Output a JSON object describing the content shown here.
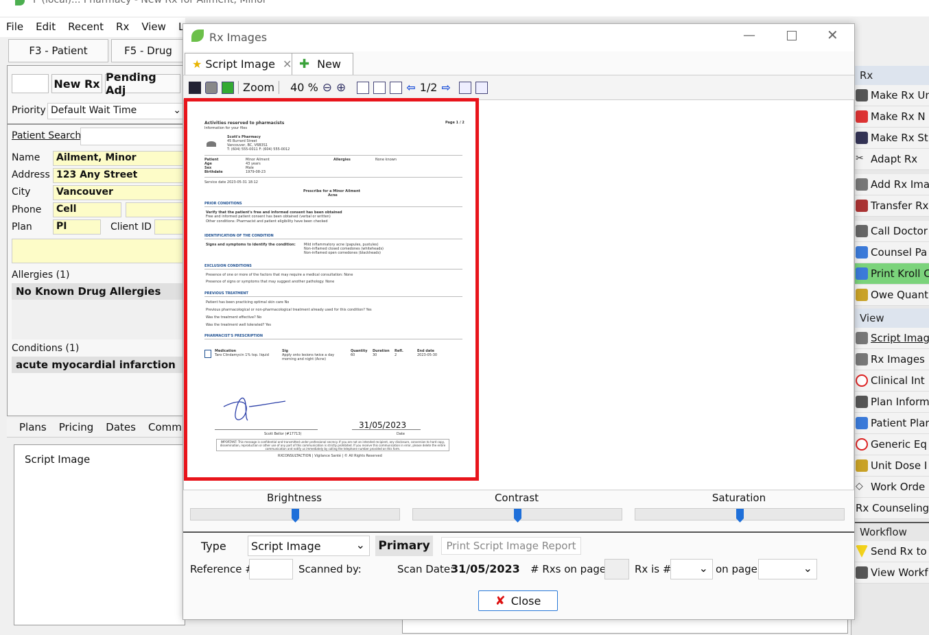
{
  "app": {
    "title": "F (local)... Pharmacy - New Rx for Ailment, Minor",
    "menu": [
      "File",
      "Edit",
      "Recent",
      "Rx",
      "View",
      "La"
    ],
    "fkeys": [
      "F3 - Patient",
      "F5 - Drug"
    ],
    "rxbuttons": [
      "New Rx",
      "Pending Adj"
    ],
    "priority_label": "Priority",
    "priority_value": "Default Wait Time",
    "patient_search_label": "Patient Search",
    "fields": {
      "name_label": "Name",
      "name": "Ailment, Minor",
      "address_label": "Address",
      "address": "123 Any Street",
      "city_label": "City",
      "city": "Vancouver",
      "phone_label": "Phone",
      "phone": "Cell",
      "plan_label": "Plan",
      "plan": "PI",
      "client_id_label": "Client ID"
    },
    "allergies_label": "Allergies (1)",
    "allergies_value": "No Known Drug Allergies",
    "conditions_label": "Conditions (1)",
    "conditions_value": "acute myocardial infarction",
    "bottom_tabs": [
      "Plans",
      "Pricing",
      "Dates",
      "Comm"
    ],
    "script_image_label": "Script Image"
  },
  "right_panel": {
    "rx_section": "Rx",
    "rx_items": [
      "Make Rx Un",
      "Make Rx N",
      "Make Rx St",
      "Adapt Rx",
      "Add Rx Ima",
      "Transfer Rx",
      "Call Doctor",
      "Counsel Pa",
      "Print Kroll C",
      "Owe Quant"
    ],
    "view_section": "View",
    "view_items": [
      "Script Imag",
      "Rx Images",
      "Clinical Int",
      "Plan Inform",
      "Patient Plar",
      "Generic Eq",
      "Unit Dose I",
      "Work Orde",
      "Rx Counseling"
    ],
    "workflow_section": "Workflow",
    "workflow_items": [
      "Send Rx to",
      "View Workf"
    ]
  },
  "dialog": {
    "title": "Rx Images",
    "tabs": [
      "Script Image",
      "New"
    ],
    "toolbar": {
      "zoom_label": "Zoom",
      "zoom_value": "40 %",
      "page": "1/2"
    },
    "sliders": [
      {
        "label": "Brightness",
        "value": 0.5
      },
      {
        "label": "Contrast",
        "value": 0.5
      },
      {
        "label": "Saturation",
        "value": 0.5
      }
    ],
    "type_label": "Type",
    "type_value": "Script Image",
    "primary_label": "Primary",
    "print_report_label": "Print Script Image Report",
    "reference_label": "Reference #",
    "scanned_by_label": "Scanned by:",
    "scan_date_label": "Scan Date:",
    "scan_date_value": "31/05/2023",
    "rxs_on_page_label": "# Rxs on page:",
    "rx_is_label": "Rx is #",
    "on_page_label": "on page",
    "close_label": "Close"
  },
  "document": {
    "title": "Activities reserved to pharmacists",
    "subtitle": "Information for your files",
    "page": "Page 1 / 2",
    "pharmacy": "Scott's Pharmacy",
    "pharmacy_address": "45 Burrard Street",
    "pharmacy_city": "Vancouver, BC, V6B3S1",
    "pharmacy_phone": "T: (604) 555-0011     F: (604) 555-0012",
    "patient_labels": [
      "Patient",
      "Age",
      "Sex",
      "Birthdate"
    ],
    "patient_values": [
      "Minor Ailment",
      "43 years",
      "Male",
      "1979-08-23"
    ],
    "allergies_label": "Allergies",
    "allergies_value": "None known",
    "service_date": "Service date  2023-05-31 18:12",
    "prescribe_for": "Prescribe for a Minor Ailment",
    "ailment": "Acne",
    "sections": [
      "PRIOR CONDITIONS",
      "IDENTIFICATION OF THE CONDITION",
      "EXCLUSION CONDITIONS",
      "PREVIOUS TREATMENT",
      "PHARMACIST'S PRESCRIPTION"
    ],
    "prior_1": "Verify that the patient's free and informed consent has been obtained",
    "prior_2": "Free and informed patient consent has been obtained (verbal or written)",
    "prior_3": "Other conditions:  Pharmacist and patient eligibility have been checked",
    "ident_label": "Signs and symptoms to identify the condition:",
    "ident_1": "Mild inflammatory acne (papules, pustules)",
    "ident_2": "Non-inflamed closed comedones (whiteheads)",
    "ident_3": "Non-inflamed open comedones (blackheads)",
    "excl_1": "Presence of one or more of the factors that may require a medical consultation:  None",
    "excl_2": "Presence of signs or symptoms that may suggest another pathology:  None",
    "prev_1": "Patient has been practicing optimal skin care  No",
    "prev_2": "Previous pharmacological or non-pharmacological treatment already used for this condition?  Yes",
    "prev_3": "Was the treatment effective?  No",
    "prev_4": "Was the treatment well tolerated?  Yes",
    "rx_headers": [
      "Medication",
      "Sig",
      "Quantity",
      "Duration",
      "Refl.",
      "End date"
    ],
    "rx_values": [
      "Taro Clindamycin 1% top. liquid",
      "Apply onto lesions twice a day",
      "60",
      "30",
      "2",
      "2023-05-30"
    ],
    "rx_sig2": "morning and night (Acne)",
    "signature_name": "Scott Bellor (#17713)",
    "date_value": "31/05/2023",
    "date_label": "Date",
    "footer": "IMPORTANT: This message is confidential and transmitted under professional secrecy. If you are not an intended recipient, any disclosure, conversion to hard copy, dissemination, reproduction or other use of any part of this communication is strictly prohibited. If you receive this communication in error, please delete the entire communication and notify us immediately by calling the telephone number provided on this form.",
    "footer_brand": "RXCONSULTACTION  |  Vigilance Santé  |  © All Rights Reserved"
  }
}
